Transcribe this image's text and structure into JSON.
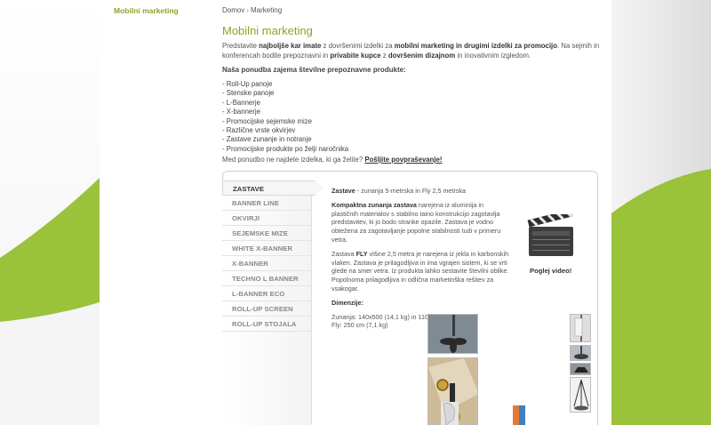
{
  "sidebar": {
    "title": "Mobilni marketing"
  },
  "breadcrumb": {
    "home": "Domov",
    "separator": "›",
    "current": "Marketing"
  },
  "page": {
    "title": "Mobilni marketing",
    "intro": {
      "t1": "Predstavite ",
      "b1": "najboljše kar imate",
      "t2": " z dovršenimi izdelki za ",
      "b2": "mobilni marketing in drugimi izdelki za promocijo",
      "t3": ". Na sejmih in konferencah bodite prepoznavni in ",
      "b3": "privabite kupce",
      "t4": " z ",
      "b4": "dovršenim dizajnom",
      "t5": " in inovativnim izgledom."
    },
    "subheading": "Naša ponudba zajema številne prepoznavne produkte:",
    "products": [
      "- Roll-Up panoje",
      "- Stenske panoje",
      "- L-Bannerje",
      "- X-bannerje",
      "- Promocijske sejemske mize",
      "- Različne vrste okvirjev",
      "- Zastave zunanje in notranje",
      "- Promocijske produkte po želji naročnika"
    ],
    "inquiry_text": "Med ponudbo ne najdete izdelka, ki ga želite?",
    "inquiry_link": "Pošljite povpraševanje!"
  },
  "tabs": [
    {
      "label": "ZASTAVE",
      "active": true
    },
    {
      "label": "BANNER LINE",
      "active": false
    },
    {
      "label": "OKVIRJI",
      "active": false
    },
    {
      "label": "SEJEMSKE MIZE",
      "active": false
    },
    {
      "label": "WHITE X-BANNER",
      "active": false
    },
    {
      "label": "X-BANNER",
      "active": false
    },
    {
      "label": "TECHNO L BANNER",
      "active": false
    },
    {
      "label": "L-BANNER ECO",
      "active": false
    },
    {
      "label": "ROLL-UP SCREEN",
      "active": false
    },
    {
      "label": "ROLL-UP STOJALA",
      "active": false
    }
  ],
  "product": {
    "name": "Zastave",
    "subtitle": " - zunanja 5-metrska in Fly 2,5 metrska",
    "p1_bold": "Kompaktna zunanja zastava",
    "p1_text": " narejena iz aluminija in plastičnih materialov s stabilno taino konstrukcijo zagotavlja predstavitev, ki jo bodo stranke opazile. Zastava je vodno obtežena za zagotavljanje popolne stabilnosti tudi v primeru vetra.",
    "p2_pre": "Zastava ",
    "p2_bold": "FLY",
    "p2_text": " višine 2,5 metra je narejena iz jekla in karbonskih vlaken. Zastava je prilagodljiva in ima vgrajen sistem, ki se vrti glede na smer vetra. Iz produkta lahko sestavite številni oblike. Popolnoma prilagodljiva in odlična marketinška rešitev za vsakogar.",
    "dims_label": "Dimenzije:",
    "dims_1": "Zunanja: 140x500 (14,1 kg) in 110x330 (12,1 kg)",
    "dims_2": "Fly: 250 cm (7,1 kg)",
    "video_label": "Poglej video!"
  },
  "colors": {
    "accent": "#8aa52b",
    "swoosh": "#9bc23b"
  }
}
